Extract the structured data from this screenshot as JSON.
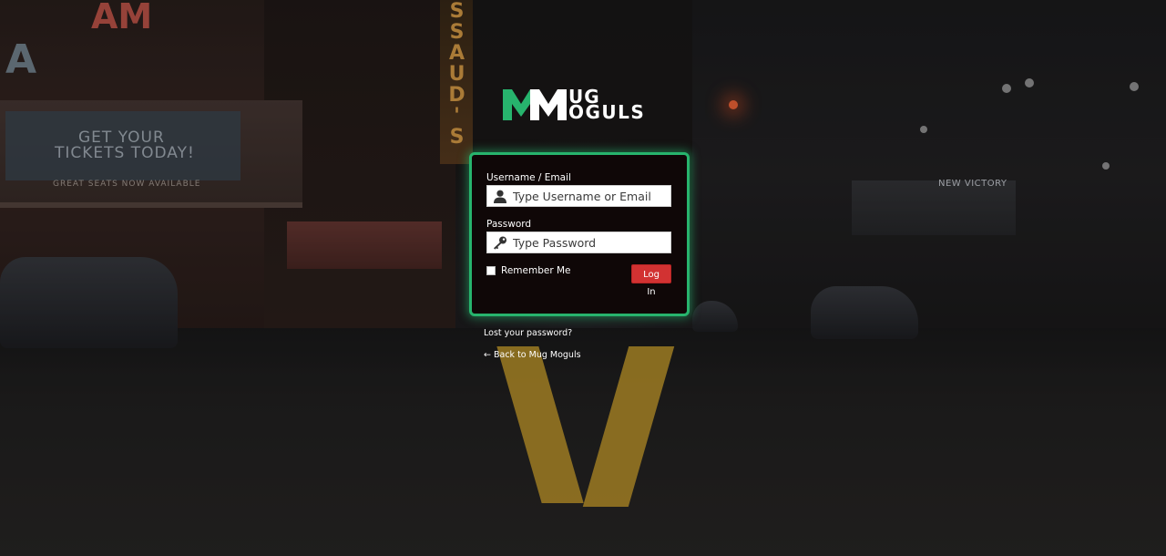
{
  "brand": {
    "logo_mark": "MM",
    "logo_line1": "UG",
    "logo_line2": "OGULS",
    "accent_green": "#27b46d",
    "login_red": "#d23232"
  },
  "background": {
    "sign_left_vertical": "AM",
    "sign_left_a": "A",
    "marquee_line1": "GET YOUR",
    "marquee_line2": "TICKETS TODAY!",
    "marquee_line3": "GREAT SEATS NOW AVAILABLE",
    "vertical_sign": "SSAUD'S",
    "right_sign": "NEW VICTORY"
  },
  "login": {
    "username_label": "Username / Email",
    "username_placeholder": "Type Username or Email",
    "username_icon": "user-icon",
    "password_label": "Password",
    "password_placeholder": "Type Password",
    "password_icon": "key-icon",
    "remember_label": "Remember Me",
    "remember_checked": false,
    "submit_label": "Log In"
  },
  "links": {
    "lost_password": "Lost your password?",
    "back_to_site": "← Back to Mug Moguls"
  }
}
